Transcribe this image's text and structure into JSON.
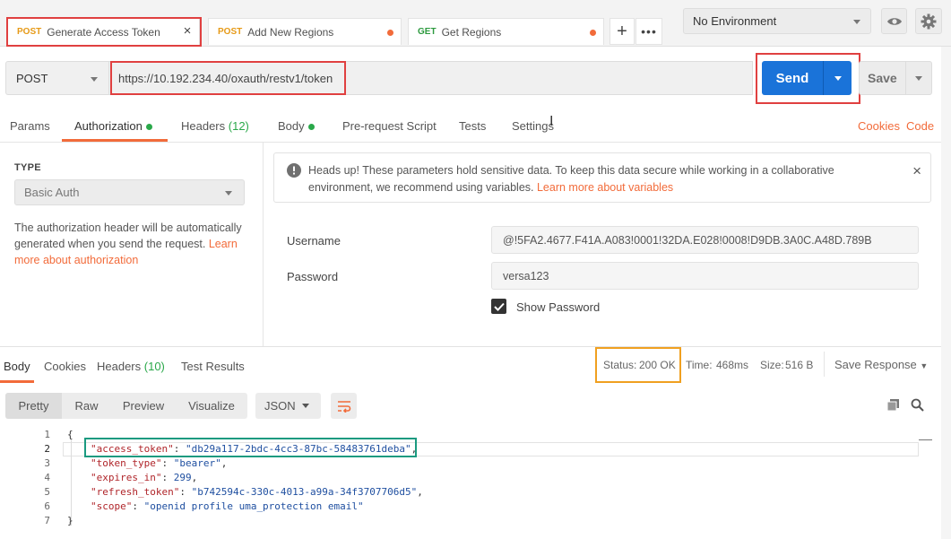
{
  "tabs": [
    {
      "method": "POST",
      "label": "Generate Access Token",
      "active": true
    },
    {
      "method": "POST",
      "label": "Add New Regions"
    },
    {
      "method": "GET",
      "label": "Get Regions"
    }
  ],
  "environment": "No Environment",
  "request": {
    "method": "POST",
    "url": "https://10.192.234.40/oxauth/restv1/token",
    "send_label": "Send",
    "save_label": "Save"
  },
  "subtabs": {
    "params": "Params",
    "authorization": "Authorization",
    "headers": "Headers",
    "headers_count": "(12)",
    "body": "Body",
    "prerequest": "Pre-request Script",
    "tests": "Tests",
    "settings": "Settings",
    "cookies": "Cookies",
    "code": "Code"
  },
  "auth": {
    "type_label": "TYPE",
    "type_value": "Basic Auth",
    "help_text": "The authorization header will be automatically generated when you send the request. ",
    "help_link": "Learn more about authorization",
    "alert_text": "Heads up! These parameters hold sensitive data. To keep this data secure while working in a collaborative environment, we recommend using variables. ",
    "alert_link": "Learn more about variables",
    "username_label": "Username",
    "username_value": "@!5FA2.4677.F41A.A083!0001!32DA.E028!0008!D9DB.3A0C.A48D.789B",
    "password_label": "Password",
    "password_value": "versa123",
    "show_password_label": "Show Password"
  },
  "response": {
    "tabs": {
      "body": "Body",
      "cookies": "Cookies",
      "headers": "Headers",
      "headers_count": "(10)",
      "test_results": "Test Results"
    },
    "status_label": "Status:",
    "status_value": "200 OK",
    "time_label": "Time:",
    "time_value": "468ms",
    "size_label": "Size:",
    "size_value": "516 B",
    "save_response": "Save Response",
    "views": {
      "pretty": "Pretty",
      "raw": "Raw",
      "preview": "Preview",
      "visualize": "Visualize",
      "format": "JSON"
    },
    "lines": [
      {
        "n": "1",
        "brace": "{"
      },
      {
        "n": "2",
        "key": "\"access_token\"",
        "sep": ": ",
        "val": "\"db29a117-2bdc-4cc3-87bc-58483761deba\"",
        "end": ","
      },
      {
        "n": "3",
        "key": "\"token_type\"",
        "sep": ": ",
        "val": "\"bearer\"",
        "end": ","
      },
      {
        "n": "4",
        "key": "\"expires_in\"",
        "sep": ": ",
        "val": "299",
        "end": ","
      },
      {
        "n": "5",
        "key": "\"refresh_token\"",
        "sep": ": ",
        "val": "\"b742594c-330c-4013-a99a-34f3707706d5\"",
        "end": ","
      },
      {
        "n": "6",
        "key": "\"scope\"",
        "sep": ": ",
        "val": "\"openid profile uma_protection email\"",
        "end": ""
      },
      {
        "n": "7",
        "brace": "}"
      }
    ]
  },
  "colors": {
    "accent_orange": "#f26b3a",
    "send_blue": "#1a73d9",
    "status_green": "#2aa84a",
    "highlight_red": "#e04040",
    "highlight_orange": "#f0a020",
    "highlight_teal": "#1a9a80"
  }
}
